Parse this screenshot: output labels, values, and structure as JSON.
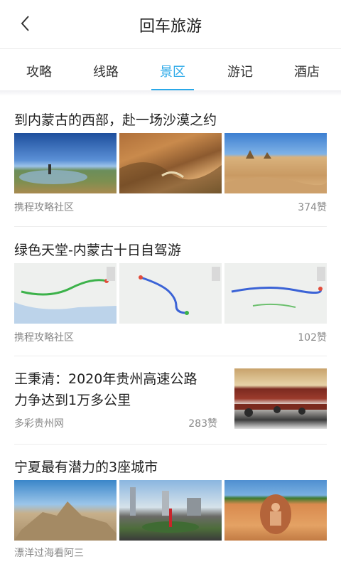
{
  "header": {
    "title": "回车旅游"
  },
  "tabs": [
    {
      "label": "攻略",
      "active": false
    },
    {
      "label": "线路",
      "active": false
    },
    {
      "label": "景区",
      "active": true
    },
    {
      "label": "游记",
      "active": false
    },
    {
      "label": "酒店",
      "active": false
    }
  ],
  "accent_color": "#2aa8e8",
  "articles": [
    {
      "title": "到内蒙古的西部，赴一场沙漠之约",
      "source": "携程攻略社区",
      "likes": "374赞"
    },
    {
      "title": "绿色天堂-内蒙古十日自驾游",
      "source": "携程攻略社区",
      "likes": "102赞"
    },
    {
      "title_line1": "王秉清：2020年贵州高速公路",
      "title_line2": "力争达到1万多公里",
      "source": "多彩贵州网",
      "likes": "283赞"
    },
    {
      "title": "宁夏最有潜力的3座城市",
      "source": "漂洋过海看阿三"
    }
  ]
}
